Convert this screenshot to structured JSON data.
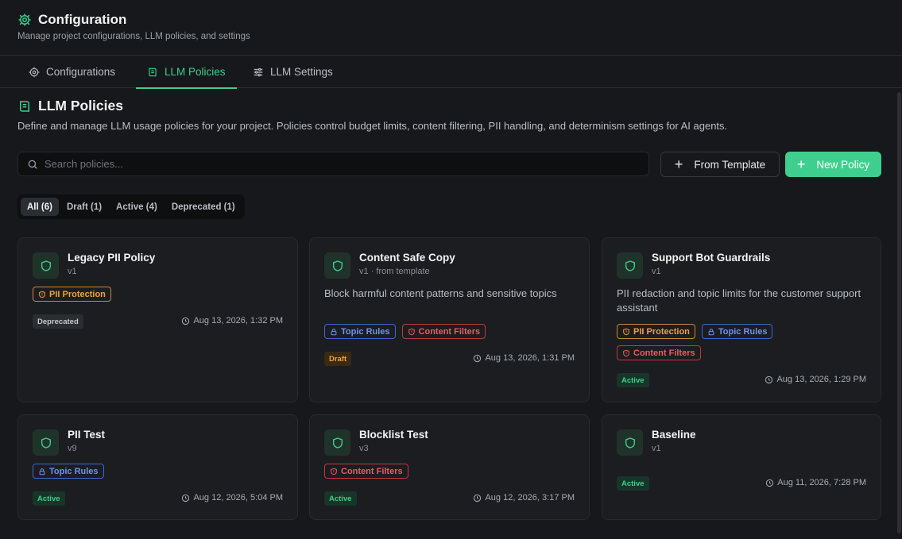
{
  "header": {
    "title": "Configuration",
    "subtitle": "Manage project configurations, LLM policies, and settings",
    "icon": "gear-icon"
  },
  "tabs": [
    {
      "label": "Configurations",
      "icon": "gear-icon",
      "active": false
    },
    {
      "label": "LLM Policies",
      "icon": "scroll-icon",
      "active": true
    },
    {
      "label": "LLM Settings",
      "icon": "sliders-icon",
      "active": false
    }
  ],
  "section": {
    "title": "LLM Policies",
    "description": "Define and manage LLM usage policies for your project. Policies control budget limits, content filtering, PII handling, and determinism settings for AI agents."
  },
  "search": {
    "placeholder": "Search policies...",
    "value": ""
  },
  "buttons": {
    "from_template": "From Template",
    "new_policy": "New Policy"
  },
  "filters": [
    {
      "label": "All (6)",
      "active": true
    },
    {
      "label": "Draft (1)",
      "active": false
    },
    {
      "label": "Active (4)",
      "active": false
    },
    {
      "label": "Deprecated (1)",
      "active": false
    }
  ],
  "policies": [
    {
      "name": "Legacy PII Policy",
      "version": "v1",
      "description": "",
      "tags": [
        "PII Protection"
      ],
      "status": "Deprecated",
      "date": "Aug 13, 2026, 1:32 PM"
    },
    {
      "name": "Content Safe Copy",
      "version": "v1 · from template",
      "description": "Block harmful content patterns and sensitive topics",
      "tags": [
        "Topic Rules",
        "Content Filters"
      ],
      "status": "Draft",
      "date": "Aug 13, 2026, 1:31 PM"
    },
    {
      "name": "Support Bot Guardrails",
      "version": "v1",
      "description": "PII redaction and topic limits for the customer support assistant",
      "tags": [
        "PII Protection",
        "Topic Rules",
        "Content Filters"
      ],
      "status": "Active",
      "date": "Aug 13, 2026, 1:29 PM"
    },
    {
      "name": "PII Test",
      "version": "v9",
      "description": "",
      "tags": [
        "Topic Rules"
      ],
      "status": "Active",
      "date": "Aug 12, 2026, 5:04 PM"
    },
    {
      "name": "Blocklist Test",
      "version": "v3",
      "description": "",
      "tags": [
        "Content Filters"
      ],
      "status": "Active",
      "date": "Aug 12, 2026, 3:17 PM"
    },
    {
      "name": "Baseline",
      "version": "v1",
      "description": "",
      "tags": [],
      "status": "Active",
      "date": "Aug 11, 2026, 7:28 PM"
    }
  ],
  "colors": {
    "accent": "#3ecf8e",
    "background": "#16181b",
    "card": "#1b1d20",
    "pii": "#f0a13a",
    "topic": "#6b93f5",
    "content": "#ef5a5f"
  }
}
